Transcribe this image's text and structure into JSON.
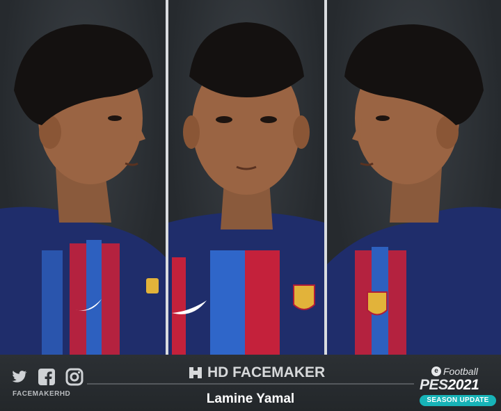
{
  "brand": {
    "name": "HD FACEMAKER"
  },
  "player": {
    "name": "Lamine Yamal"
  },
  "social": {
    "handle": "FACEMAKERHD",
    "icons": [
      "twitter-icon",
      "facebook-icon",
      "instagram-icon"
    ]
  },
  "game": {
    "efootball": "Football",
    "pes": "PES",
    "year": "2021",
    "badge": "SEASON UPDATE"
  },
  "colors": {
    "background": "#2b2f33",
    "badge": "#17b3b7",
    "kit_blue": "#1f2d6b",
    "kit_red": "#c4213b"
  }
}
